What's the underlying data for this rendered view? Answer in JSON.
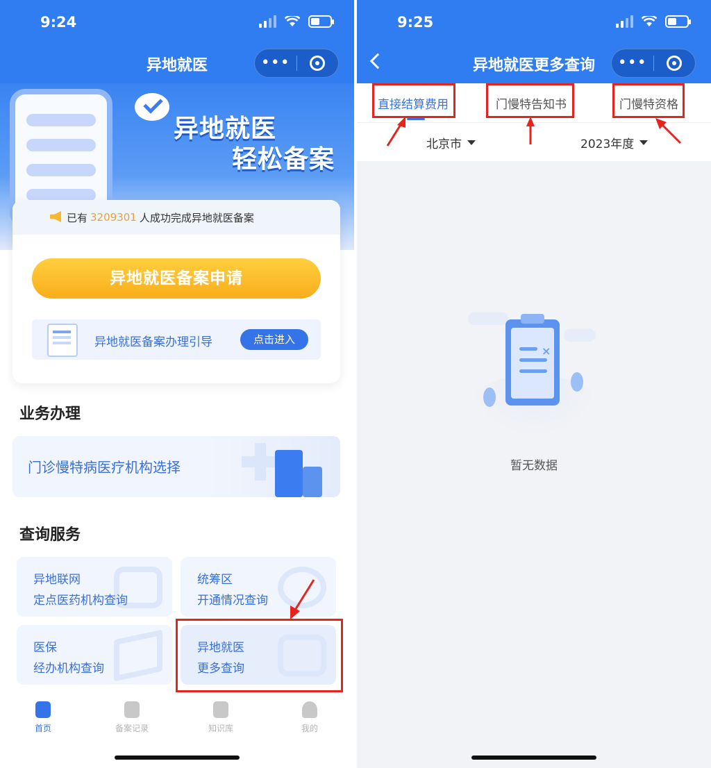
{
  "left": {
    "status": {
      "time": "9:24"
    },
    "nav": {
      "title": "异地就医",
      "more": "•••"
    },
    "banner": {
      "line1": "异地就医",
      "line2": "轻松备案"
    },
    "notice": {
      "prefix": "已有",
      "count": "3209301",
      "suffix": "人成功完成异地就医备案"
    },
    "apply_button": "异地就医备案申请",
    "guide": {
      "text": "异地就医备案办理引导",
      "button": "点击进入"
    },
    "business": {
      "title": "业务办理",
      "clinic_card": "门诊慢特病医疗机构选择"
    },
    "query": {
      "title": "查询服务",
      "cards": [
        {
          "line1": "异地联网",
          "line2": "定点医药机构查询"
        },
        {
          "line1": "统筹区",
          "line2": "开通情况查询"
        },
        {
          "line1": "医保",
          "line2": "经办机构查询"
        },
        {
          "line1": "异地就医",
          "line2": "更多查询"
        }
      ]
    },
    "tabbar": [
      {
        "label": "首页",
        "active": true
      },
      {
        "label": "备案记录",
        "active": false
      },
      {
        "label": "知识库",
        "active": false
      },
      {
        "label": "我的",
        "active": false
      }
    ]
  },
  "right": {
    "status": {
      "time": "9:25"
    },
    "nav": {
      "title": "异地就医更多查询",
      "more": "•••"
    },
    "tabs": [
      {
        "label": "直接结算费用",
        "active": true
      },
      {
        "label": "门慢特告知书",
        "active": false
      },
      {
        "label": "门慢特资格",
        "active": false
      }
    ],
    "filters": {
      "city": "北京市",
      "year": "2023年度"
    },
    "empty_text": "暂无数据"
  },
  "colors": {
    "primary": "#2f7df0",
    "accent_yellow": "#f9ad1b",
    "annotation_red": "#e5241d",
    "count_orange": "#e6a23c"
  }
}
